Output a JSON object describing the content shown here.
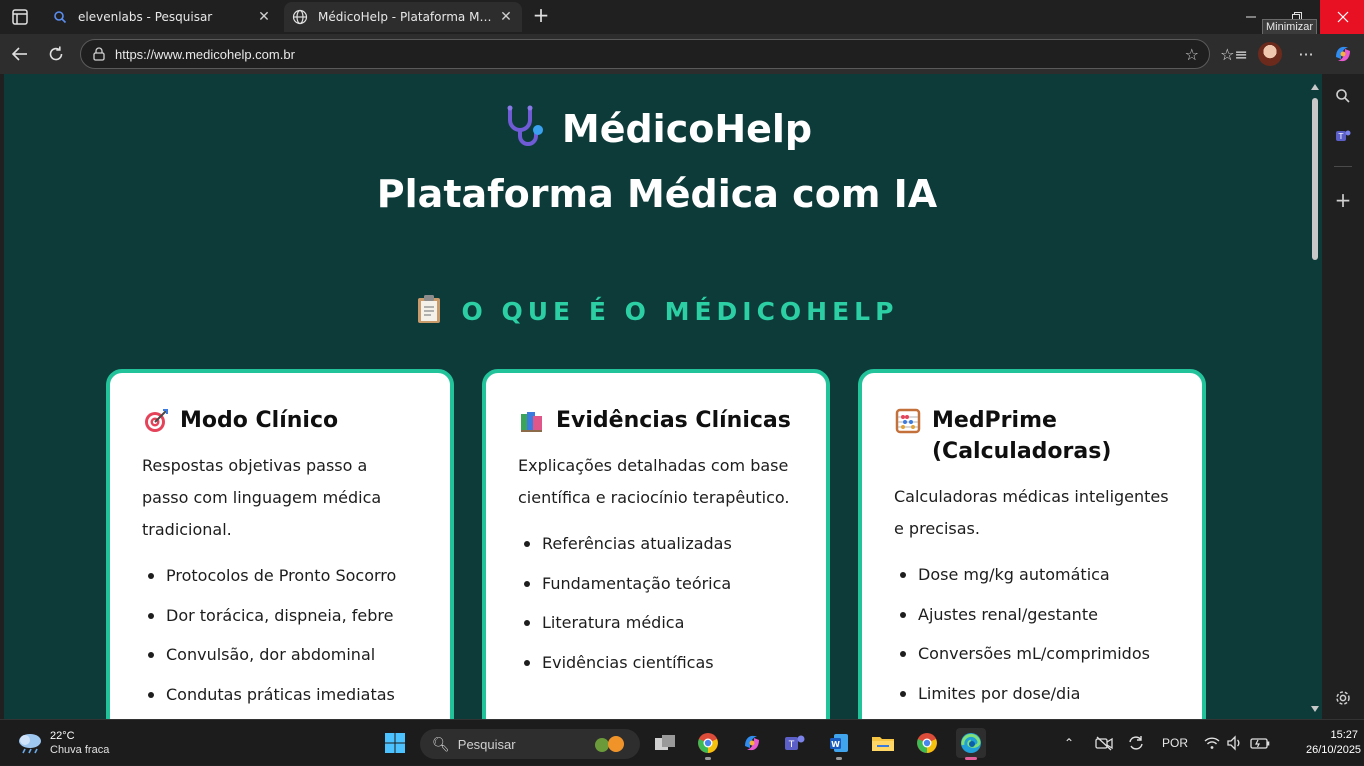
{
  "browser": {
    "tabs": [
      {
        "title": "elevenlabs - Pesquisar",
        "active": false,
        "icon": "search-icon"
      },
      {
        "title": "MédicoHelp - Plataforma Médica com IA",
        "active": true,
        "icon": "globe-icon"
      }
    ],
    "tooltip": "Minimizar",
    "url": "https://www.medicohelp.com.br"
  },
  "page": {
    "brand": "MédicoHelp",
    "subtitle": "Plataforma Médica com IA",
    "section_title": "O QUE É O MÉDICOHELP",
    "cards": [
      {
        "emoji": "target",
        "title": "Modo Clínico",
        "description": "Respostas objetivas passo a passo com linguagem médica tradicional.",
        "items": [
          "Protocolos de Pronto Socorro",
          "Dor torácica, dispneia, febre",
          "Convulsão, dor abdominal",
          "Condutas práticas imediatas"
        ]
      },
      {
        "emoji": "books",
        "title": "Evidências Clínicas",
        "description": "Explicações detalhadas com base científica e raciocínio terapêutico.",
        "items": [
          "Referências atualizadas",
          "Fundamentação teórica",
          "Literatura médica",
          "Evidências científicas"
        ]
      },
      {
        "emoji": "abacus",
        "title": "MedPrime (Calculadoras)",
        "description": "Calculadoras médicas inteligentes e precisas.",
        "items": [
          "Dose mg/kg automática",
          "Ajustes renal/gestante",
          "Conversões mL/comprimidos",
          "Limites por dose/dia"
        ]
      }
    ],
    "colors": {
      "background": "#0c3b3a",
      "accent": "#2ccfa4",
      "card_border": "#22c39b"
    }
  },
  "taskbar": {
    "weather_temp": "22°C",
    "weather_condition": "Chuva fraca",
    "search_placeholder": "Pesquisar",
    "language": "POR",
    "time": "15:27",
    "date": "26/10/2025"
  }
}
